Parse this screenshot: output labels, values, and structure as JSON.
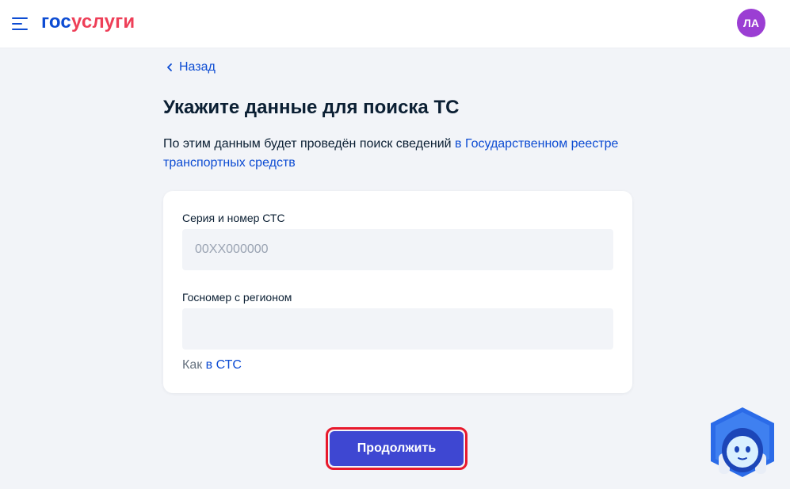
{
  "header": {
    "logo_part1": "гос",
    "logo_part2": "услуги",
    "avatar_initials": "ЛА",
    "menu_icon": "burger-menu-icon"
  },
  "nav": {
    "back_label": "Назад"
  },
  "page": {
    "title": "Укажите данные для поиска ТС",
    "description_prefix": "По этим данным будет проведён поиск сведений ",
    "description_link": "в Государственном реестре транспортных средств"
  },
  "form": {
    "sts_label": "Серия и номер СТС",
    "sts_placeholder": "00ХХ000000",
    "sts_value": "",
    "plate_label": "Госномер с регионом",
    "plate_placeholder": "",
    "plate_value": "",
    "hint_prefix": "Как ",
    "hint_link": "в СТС"
  },
  "actions": {
    "continue_label": "Продолжить"
  },
  "assistant": {
    "icon": "assistant-robot-icon"
  },
  "colors": {
    "brand_blue": "#0d4cd3",
    "brand_red": "#ee3f58",
    "background": "#f2f4f8",
    "button": "#3e47d2",
    "avatar": "#9b3ed3",
    "highlight": "#e8192c"
  }
}
